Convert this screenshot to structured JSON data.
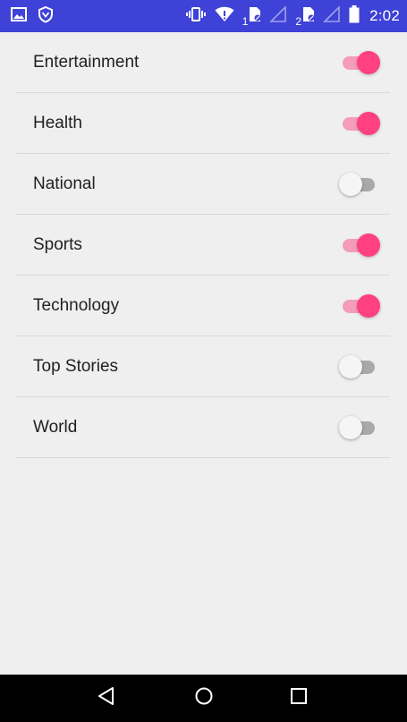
{
  "status_bar": {
    "time": "2:02",
    "sim1_label": "1",
    "sim2_label": "2",
    "icons": [
      "gallery-notification-icon",
      "vpn-shield-icon",
      "vibrate-icon",
      "wifi-icon",
      "sim1-icon",
      "signal-icon",
      "sim2-icon",
      "signal-icon",
      "battery-icon"
    ],
    "background_color": "#3f42d6"
  },
  "settings": {
    "items": [
      {
        "label": "Entertainment",
        "enabled": true
      },
      {
        "label": "Health",
        "enabled": true
      },
      {
        "label": "National",
        "enabled": false
      },
      {
        "label": "Sports",
        "enabled": true
      },
      {
        "label": "Technology",
        "enabled": true
      },
      {
        "label": "Top Stories",
        "enabled": false
      },
      {
        "label": "World",
        "enabled": false
      }
    ],
    "accent_color": "#ff4081",
    "track_on_color": "#f59cba",
    "track_off_color": "#a9a9a9"
  },
  "nav_bar": {
    "buttons": [
      "back-icon",
      "home-icon",
      "recents-icon"
    ]
  }
}
